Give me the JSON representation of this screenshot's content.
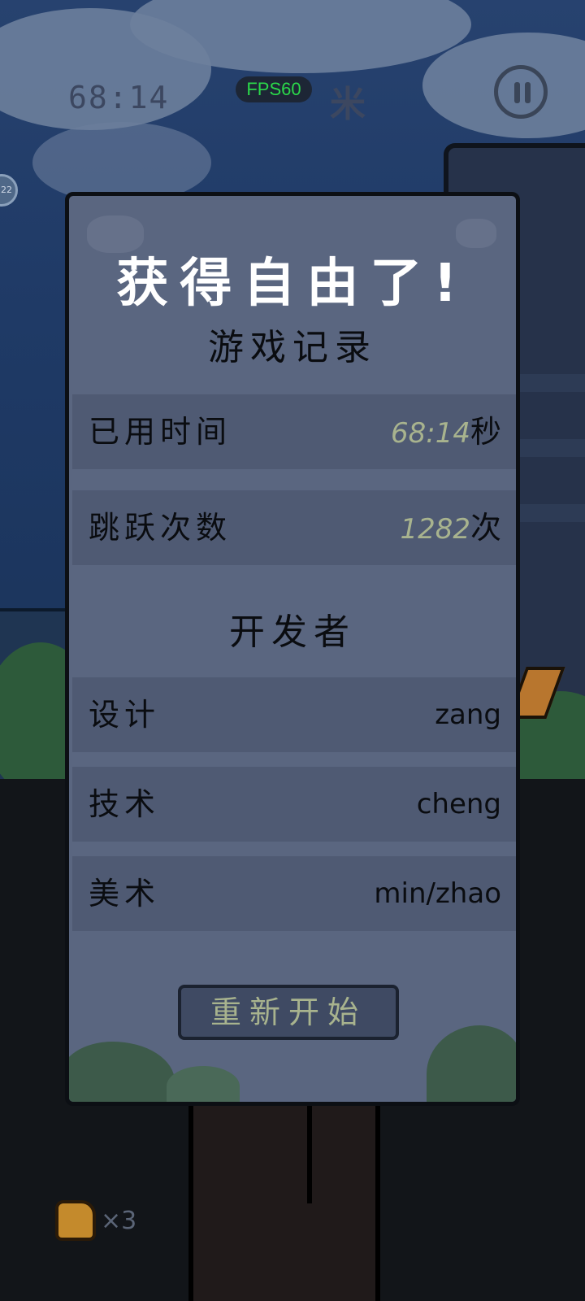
{
  "hud": {
    "timer": "68:14",
    "meters_partial": "米",
    "fps_label": "FPS60",
    "side_badge": "22"
  },
  "dialog": {
    "title": "获得自由了!",
    "record_section": "游戏记录",
    "rows": [
      {
        "label": "已用时间",
        "value": "68:14",
        "unit": "秒"
      },
      {
        "label": "跳跃次数",
        "value": "1282",
        "unit": "次"
      }
    ],
    "developer_section": "开发者",
    "developers": [
      {
        "role": "设计",
        "name": "zang"
      },
      {
        "role": "技术",
        "name": "cheng"
      },
      {
        "role": "美术",
        "name": "min/zhao"
      }
    ],
    "restart_label": "重新开始"
  },
  "lives": {
    "count": "×3"
  },
  "colors": {
    "panel": "#5a6680",
    "row": "#4f5a73",
    "accent_number": "#a8b38e",
    "fps_green": "#2bd84a"
  },
  "icons": [
    "pause-icon",
    "thumbs-up-icon"
  ]
}
